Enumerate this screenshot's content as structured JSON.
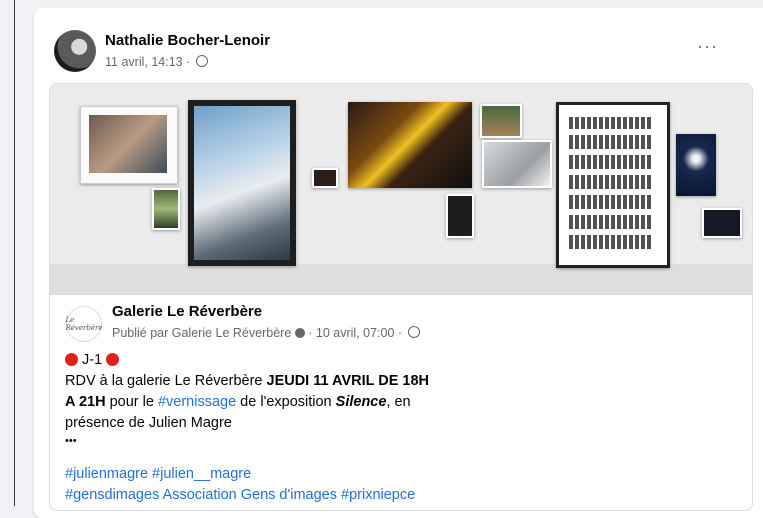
{
  "post": {
    "author": "Nathalie Bocher-Lenoir",
    "timestamp": "11 avril, 14:13 ·",
    "more_label": "···"
  },
  "shared": {
    "page_avatar_text": "Le Réverbère",
    "page_name": "Galerie Le Réverbère",
    "meta_prefix": "Publié par Galerie Le Réverbère",
    "meta_suffix": "· 10 avril, 07:00 ·",
    "countdown": "J-1",
    "line1_plain": "RDV à la galerie Le Réverbère ",
    "line1_bold": "JEUDI 11 AVRIL DE 18H",
    "line2_bold": "A 21H",
    "line2_plain": " pour le ",
    "line2_link": "#vernissage",
    "line2_after": " de l'exposition ",
    "line2_italic": "Silence",
    "line2_end": ", en",
    "line3": "présence de Julien Magre",
    "ellipsis": "•••",
    "hashtags_line1": "#julienmagre #julien__magre",
    "hashtags_line2": "#gensdimages Association Gens d'images  #prixniepce"
  },
  "colors": {
    "link": "#216fdb",
    "red_dot": "#e0201b",
    "meta": "#65676b"
  },
  "icons": [
    "globe-icon",
    "more-icon",
    "verified-icon",
    "red-circle-icon"
  ]
}
